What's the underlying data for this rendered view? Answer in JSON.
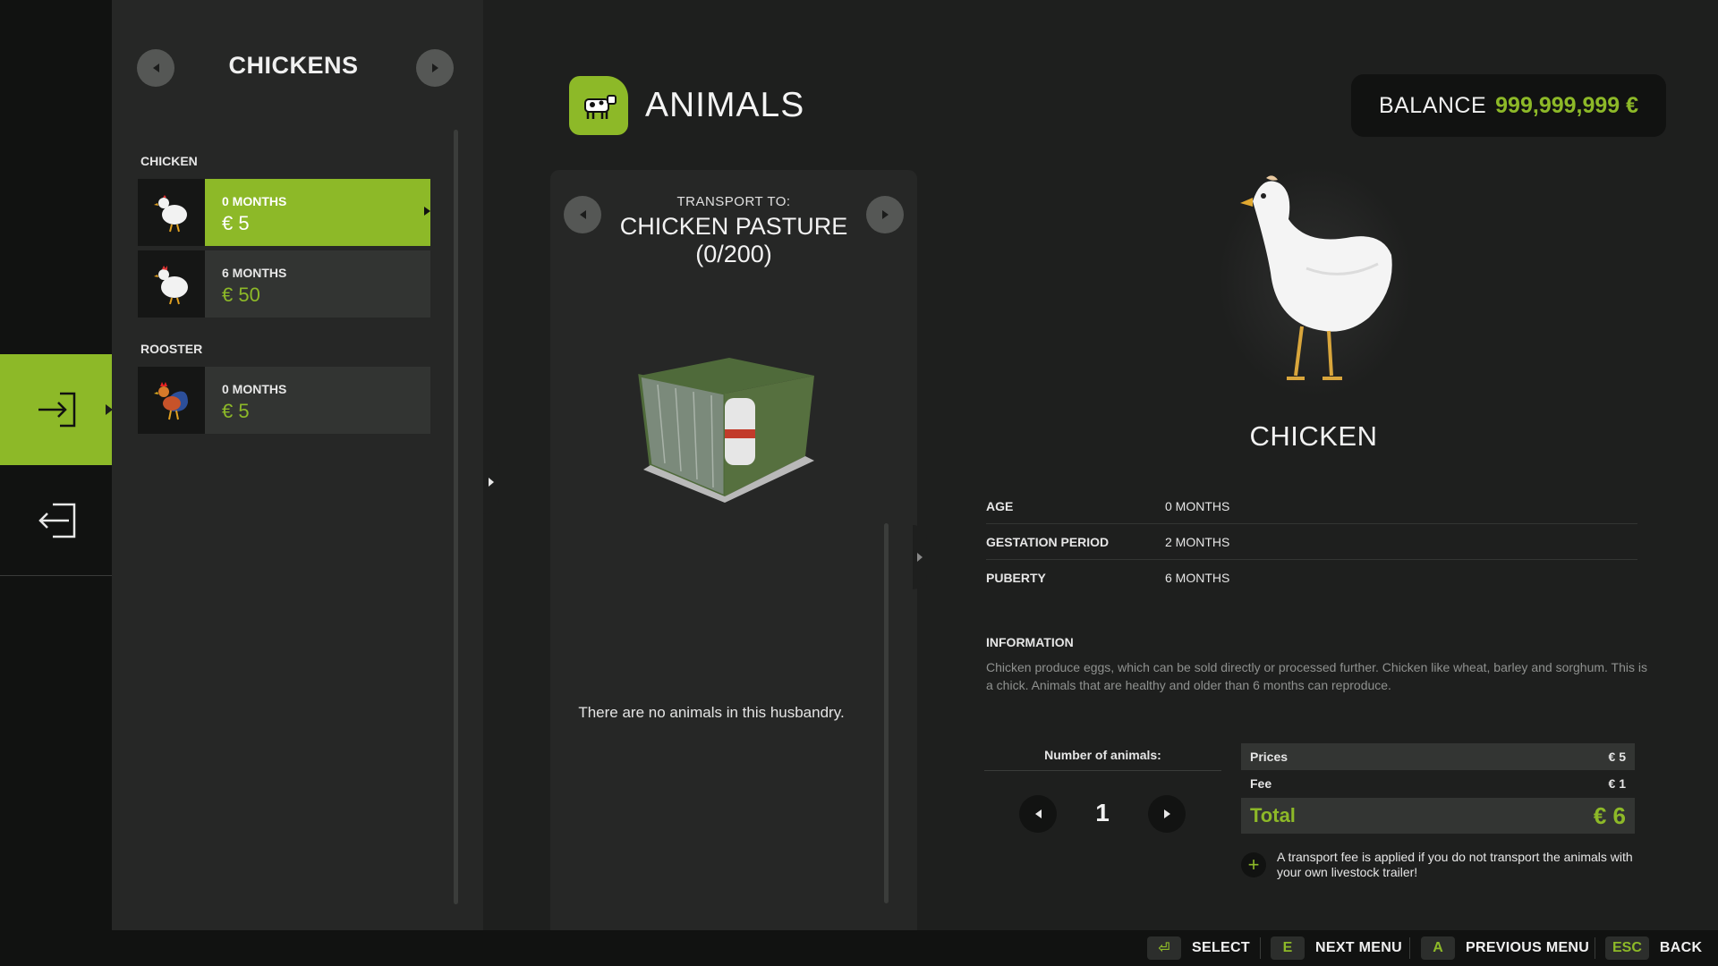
{
  "app": {
    "title": "ANIMALS",
    "icon": "cow-icon"
  },
  "balance": {
    "label": "BALANCE",
    "value": "999,999,999 €"
  },
  "colors": {
    "accent": "#8db928",
    "panel": "#262726",
    "dark": "#111211"
  },
  "rail": {
    "buy_icon": "enter-icon",
    "back_icon": "exit-icon"
  },
  "list": {
    "category": "CHICKENS",
    "groups": [
      {
        "label": "CHICKEN",
        "items": [
          {
            "age": "0 MONTHS",
            "price": "€ 5",
            "selected": true
          },
          {
            "age": "6 MONTHS",
            "price": "€ 50",
            "selected": false
          }
        ]
      },
      {
        "label": "ROOSTER",
        "items": [
          {
            "age": "0 MONTHS",
            "price": "€ 5",
            "selected": false
          }
        ]
      }
    ]
  },
  "husbandry": {
    "transport_label": "TRANSPORT TO:",
    "name": "CHICKEN PASTURE (0/200)",
    "empty_message": "There are no animals in this husbandry."
  },
  "detail": {
    "name": "CHICKEN",
    "attributes": [
      {
        "key": "AGE",
        "value": "0 MONTHS"
      },
      {
        "key": "GESTATION PERIOD",
        "value": "2 MONTHS"
      },
      {
        "key": "PUBERTY",
        "value": "6 MONTHS"
      }
    ],
    "info_title": "INFORMATION",
    "info_text": "Chicken produce eggs, which can be sold directly or processed further. Chicken like wheat, barley and sorghum. This is a chick. Animals that are healthy and older than 6 months can reproduce."
  },
  "purchase": {
    "number_label": "Number of animals:",
    "quantity": "1",
    "prices_label": "Prices",
    "prices_value": "€ 5",
    "fee_label": "Fee",
    "fee_value": "€ 1",
    "total_label": "Total",
    "total_value": "€ 6",
    "fee_note": "A transport fee is applied if you do not transport the animals with your own livestock trailer!"
  },
  "hints": [
    {
      "key": "⏎",
      "label": "SELECT"
    },
    {
      "key": "E",
      "label": "NEXT MENU"
    },
    {
      "key": "A",
      "label": "PREVIOUS MENU"
    },
    {
      "key": "ESC",
      "label": "BACK"
    }
  ]
}
